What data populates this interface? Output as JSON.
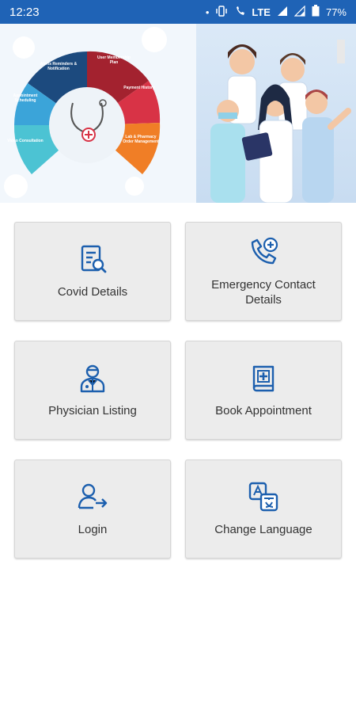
{
  "status_bar": {
    "time": "12:23",
    "network": "LTE",
    "battery": "77%"
  },
  "banner": {
    "wheel_segments": [
      "Alerts Reminders & Notification",
      "User Membership Plan",
      "Payment History",
      "Lab & Pharmacy Order Management",
      "Video Consultation",
      "Appointment Scheduling"
    ]
  },
  "menu": {
    "tiles": [
      {
        "label": "Covid Details",
        "icon": "document-search-icon"
      },
      {
        "label": "Emergency Contact Details",
        "icon": "phone-plus-icon"
      },
      {
        "label": "Physician Listing",
        "icon": "doctor-icon"
      },
      {
        "label": "Book Appointment",
        "icon": "medical-book-icon"
      },
      {
        "label": "Login",
        "icon": "user-login-icon"
      },
      {
        "label": "Change Language",
        "icon": "translate-icon"
      }
    ]
  },
  "colors": {
    "status_bar": "#1f63b6",
    "icon_blue": "#1c5fae",
    "tile_bg": "#ececec"
  }
}
